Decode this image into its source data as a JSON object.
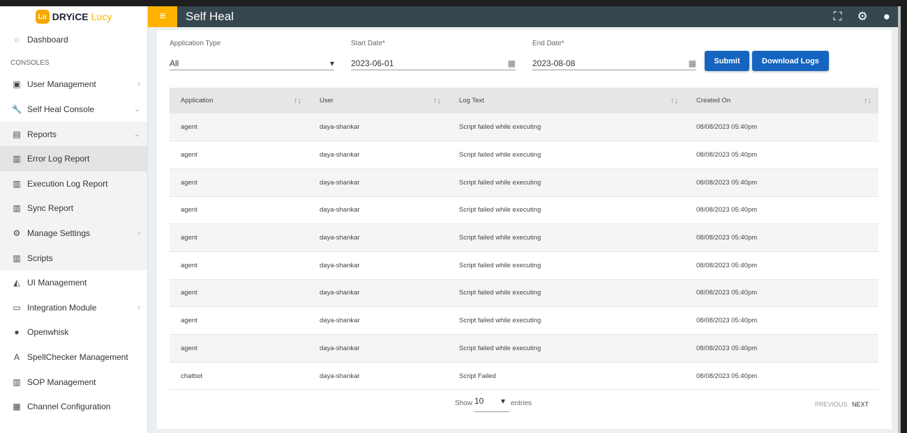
{
  "brand": {
    "mark": "Lu",
    "name": "DRYiCE",
    "product": "Lucy"
  },
  "header": {
    "title": "Self Heal"
  },
  "sidebar": {
    "section": "CONSOLES",
    "items": [
      {
        "label": "Dashboard",
        "icon": "dashboard-icon"
      },
      {
        "label": "User Management",
        "icon": "user-icon",
        "chev": "›"
      },
      {
        "label": "Self Heal Console",
        "icon": "wrench-icon",
        "chev": "⌄"
      },
      {
        "label": "Reports",
        "icon": "file-icon",
        "chev": "⌄"
      },
      {
        "label": "Error Log Report",
        "icon": "clipboard-icon"
      },
      {
        "label": "Execution Log Report",
        "icon": "clipboard-icon"
      },
      {
        "label": "Sync Report",
        "icon": "clipboard-icon"
      },
      {
        "label": "Manage Settings",
        "icon": "gear-icon",
        "chev": "›"
      },
      {
        "label": "Scripts",
        "icon": "clipboard-icon"
      },
      {
        "label": "UI Management",
        "icon": "paint-icon"
      },
      {
        "label": "Integration Module",
        "icon": "window-icon",
        "chev": "›"
      },
      {
        "label": "Openwhisk",
        "icon": "openwhisk-icon"
      },
      {
        "label": "SpellChecker Management",
        "icon": "spellcheck-icon"
      },
      {
        "label": "SOP Management",
        "icon": "clipboard-icon"
      },
      {
        "label": "Channel Configuration",
        "icon": "grid-icon"
      }
    ]
  },
  "filters": {
    "app_type_label": "Application Type",
    "app_type": "All",
    "start_label": "Start Date*",
    "start": "2023-06-01",
    "end_label": "End Date*",
    "end": "2023-08-08",
    "submit": "Submit",
    "download": "Download Logs"
  },
  "table": {
    "headers": [
      "Application",
      "User",
      "Log Text",
      "Created On"
    ],
    "rows": [
      [
        "agent",
        "daya-shankar",
        "Script failed while executing",
        "08/08/2023 05:40pm"
      ],
      [
        "agent",
        "daya-shankar",
        "Script failed while executing",
        "08/08/2023 05:40pm"
      ],
      [
        "agent",
        "daya-shankar",
        "Script failed while executing",
        "08/08/2023 05:40pm"
      ],
      [
        "agent",
        "daya-shankar",
        "Script failed while executing",
        "08/08/2023 05:40pm"
      ],
      [
        "agent",
        "daya-shankar",
        "Script failed while executing",
        "08/08/2023 05:40pm"
      ],
      [
        "agent",
        "daya-shankar",
        "Script failed while executing",
        "08/08/2023 05:40pm"
      ],
      [
        "agent",
        "daya-shankar",
        "Script failed while executing",
        "08/08/2023 05:40pm"
      ],
      [
        "agent",
        "daya-shankar",
        "Script failed while executing",
        "08/08/2023 05:40pm"
      ],
      [
        "agent",
        "daya-shankar",
        "Script failed while executing",
        "08/08/2023 05:40pm"
      ],
      [
        "chatbot",
        "daya-shankar",
        "Script Failed",
        "08/08/2023 05:40pm"
      ]
    ]
  },
  "pager": {
    "show": "Show",
    "size": "10",
    "entries": "entries",
    "prev": "PREVIOUS",
    "next": "NEXT"
  }
}
